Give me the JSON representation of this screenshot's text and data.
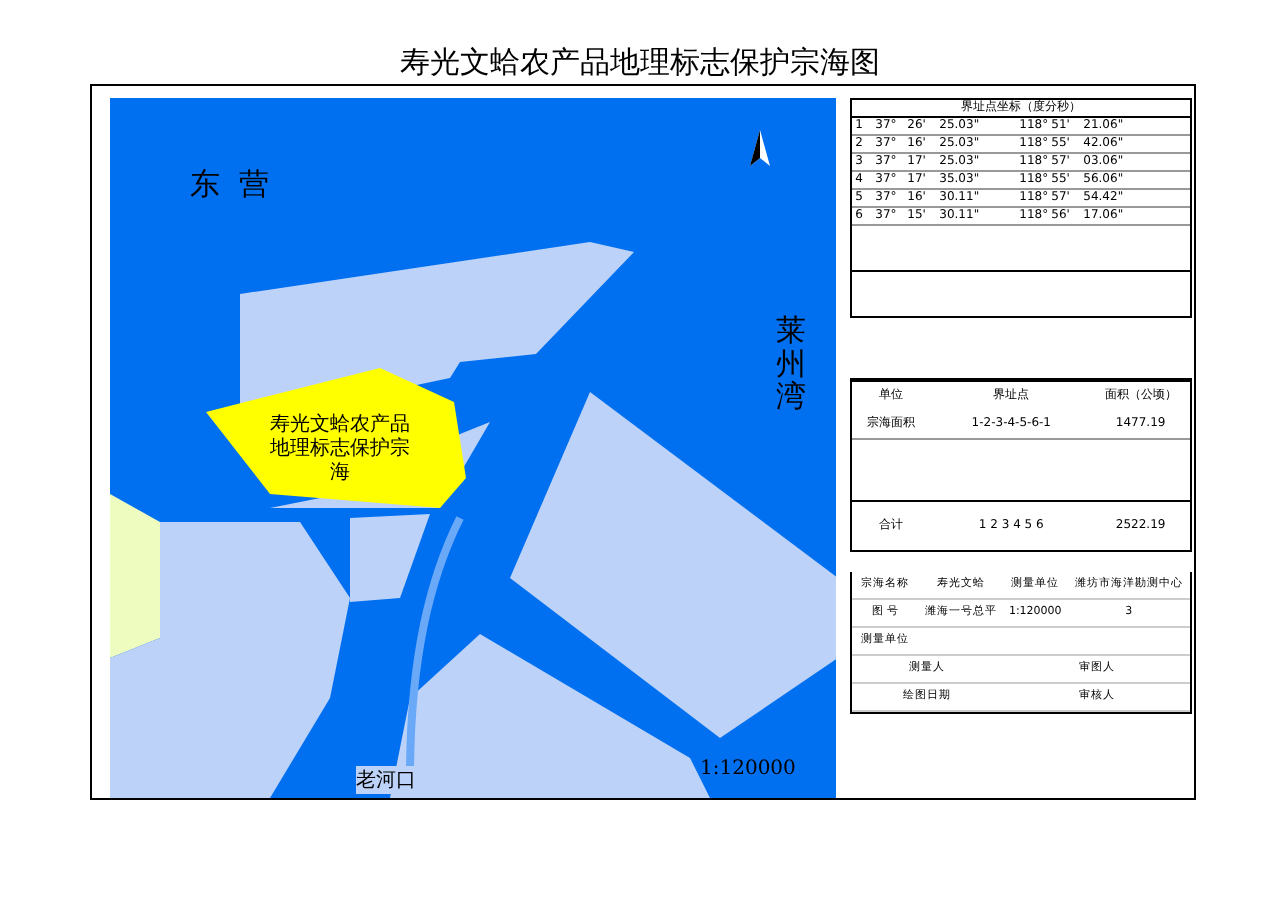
{
  "title": "寿光文蛤农产品地理标志保护宗海图",
  "map": {
    "labels": [
      {
        "kind": "horizontal",
        "text": "东  营"
      },
      {
        "kind": "vertical",
        "text": "莱州湾"
      },
      {
        "kind": "zone",
        "text": "寿光文蛤农产品地理标志保护宗海"
      },
      {
        "kind": "river",
        "text": "老河口"
      }
    ],
    "scale": "1:120000"
  },
  "coordinates": {
    "heading": "界址点坐标（度分秒）",
    "rows": [
      [
        "1",
        "37°",
        "26'",
        "25.03\"",
        "118°",
        "51'",
        "21.06\""
      ],
      [
        "2",
        "37°",
        "16'",
        "25.03\"",
        "118°",
        "55'",
        "42.06\""
      ],
      [
        "3",
        "37°",
        "17'",
        "25.03\"",
        "118°",
        "57'",
        "03.06\""
      ],
      [
        "4",
        "37°",
        "17'",
        "35.03\"",
        "118°",
        "55'",
        "56.06\""
      ],
      [
        "5",
        "37°",
        "16'",
        "30.11\"",
        "118°",
        "57'",
        "54.42\""
      ],
      [
        "6",
        "37°",
        "15'",
        "30.11\"",
        "118°",
        "56'",
        "17.06\""
      ]
    ]
  },
  "area": {
    "rows": [
      [
        "单位",
        "界址点",
        "面积（公顷）"
      ],
      [
        "宗海面积",
        "1-2-3-4-5-6-1",
        "1477.19"
      ]
    ],
    "total": [
      "合计",
      "1 2 3 4 5 6",
      "2522.19"
    ]
  },
  "info": {
    "rows": [
      [
        "宗海名称",
        "寿光文蛤",
        "测量单位",
        "潍坊市海洋勘测中心"
      ],
      [
        "图  号",
        "潍海一号总平",
        "1:120000",
        "3"
      ]
    ],
    "unit_label": "测量单位",
    "signatures": [
      [
        "测量人",
        "审图人"
      ],
      [
        "绘图日期",
        "审核人"
      ]
    ]
  }
}
